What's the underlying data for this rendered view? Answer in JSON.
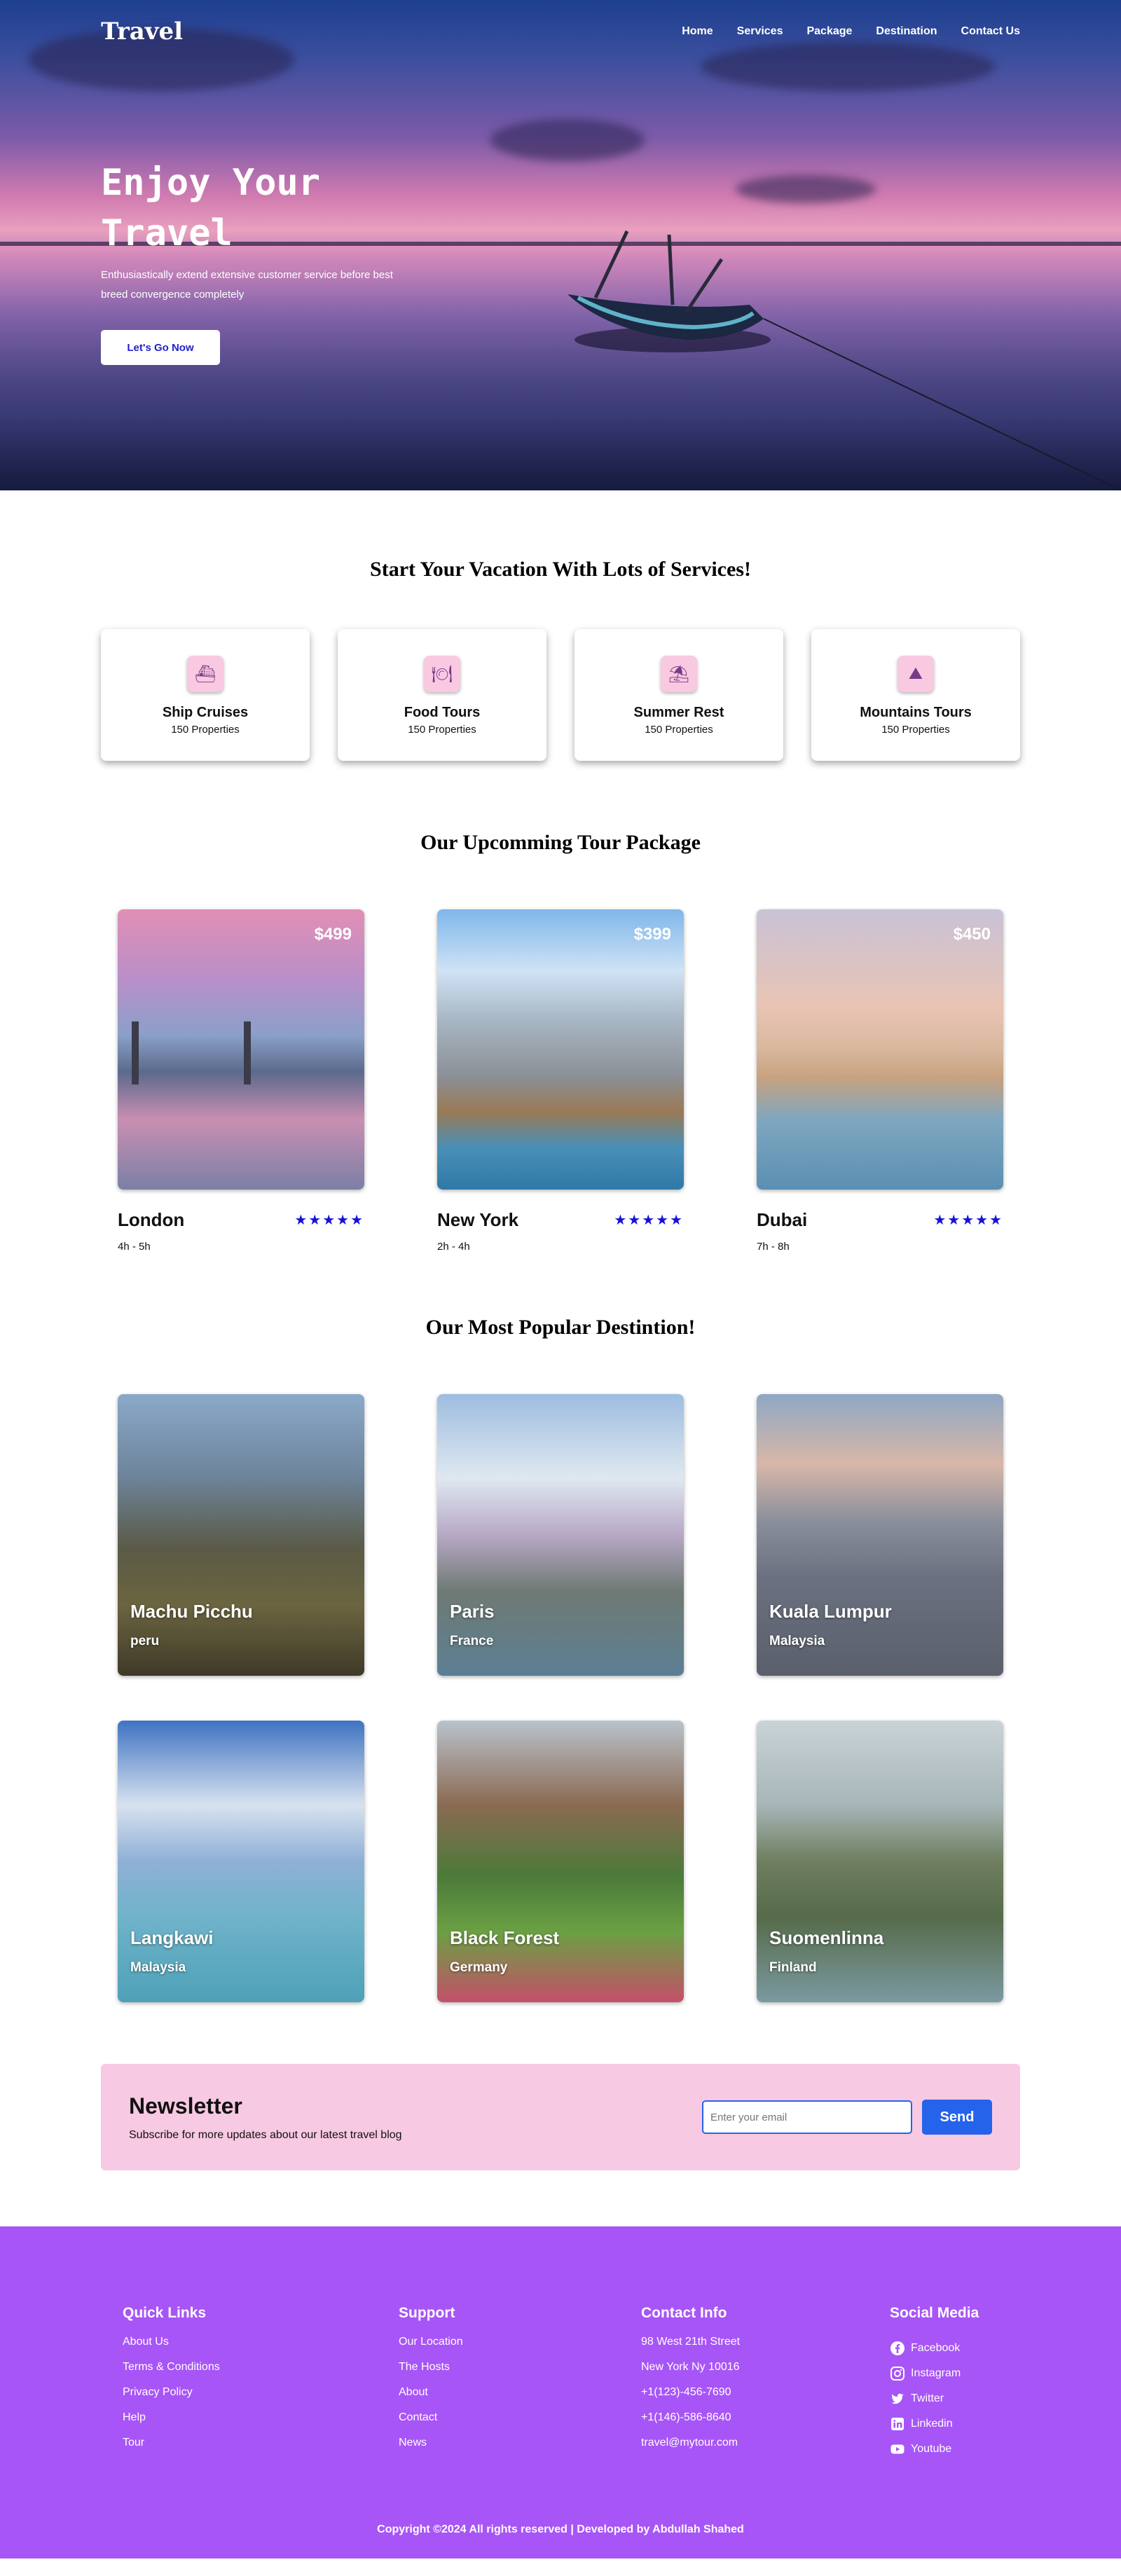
{
  "nav": {
    "logo": "Travel",
    "links": [
      "Home",
      "Services",
      "Package",
      "Destination",
      "Contact Us"
    ]
  },
  "hero": {
    "title_line1": "Enjoy Your",
    "title_line2": "Travel",
    "subtitle": "Enthusiastically extend extensive customer service before best breed convergence completely",
    "button": "Let's Go Now"
  },
  "services": {
    "title": "Start Your Vacation With Lots of Services!",
    "items": [
      {
        "name": "Ship Cruises",
        "count": "150 Properties",
        "icon": "ship-icon"
      },
      {
        "name": "Food Tours",
        "count": "150 Properties",
        "icon": "food-icon"
      },
      {
        "name": "Summer Rest",
        "count": "150 Properties",
        "icon": "umbrella-icon"
      },
      {
        "name": "Mountains Tours",
        "count": "150 Properties",
        "icon": "mountain-icon"
      }
    ]
  },
  "packages": {
    "title": "Our Upcomming Tour Package",
    "items": [
      {
        "city": "London",
        "price": "$499",
        "duration": "4h - 5h",
        "rating": 5
      },
      {
        "city": "New York",
        "price": "$399",
        "duration": "2h - 4h",
        "rating": 5
      },
      {
        "city": "Dubai",
        "price": "$450",
        "duration": "7h - 8h",
        "rating": 5
      }
    ]
  },
  "destinations": {
    "title": "Our Most Popular Destintion!",
    "items": [
      {
        "name": "Machu Picchu",
        "country": "peru"
      },
      {
        "name": "Paris",
        "country": "France"
      },
      {
        "name": "Kuala Lumpur",
        "country": "Malaysia"
      },
      {
        "name": "Langkawi",
        "country": "Malaysia"
      },
      {
        "name": "Black Forest",
        "country": "Germany"
      },
      {
        "name": "Suomenlinna",
        "country": "Finland"
      }
    ]
  },
  "newsletter": {
    "title": "Newsletter",
    "subtitle": "Subscribe for more updates about our latest travel blog",
    "placeholder": "Enter your email",
    "button": "Send"
  },
  "footer": {
    "quick_links": {
      "title": "Quick Links",
      "items": [
        "About Us",
        "Terms & Conditions",
        "Privacy Policy",
        "Help",
        "Tour"
      ]
    },
    "support": {
      "title": "Support",
      "items": [
        "Our Location",
        "The Hosts",
        "About",
        "Contact",
        "News"
      ]
    },
    "contact": {
      "title": "Contact Info",
      "items": [
        "98 West 21th Street",
        "New York Ny 10016",
        "+1(123)-456-7690",
        "+1(146)-586-8640",
        "travel@mytour.com"
      ]
    },
    "social": {
      "title": "Social Media",
      "items": [
        "Facebook",
        "Instagram",
        "Twitter",
        "Linkedin",
        "Youtube"
      ]
    },
    "copyright": "Copyright ©2024 All rights reserved | Developed by Abdullah Shahed"
  },
  "colors": {
    "accent_blue": "#2563eb",
    "star_blue": "#1512d6",
    "footer_purple": "#a855f7",
    "newsletter_pink": "#f8c9e2"
  }
}
